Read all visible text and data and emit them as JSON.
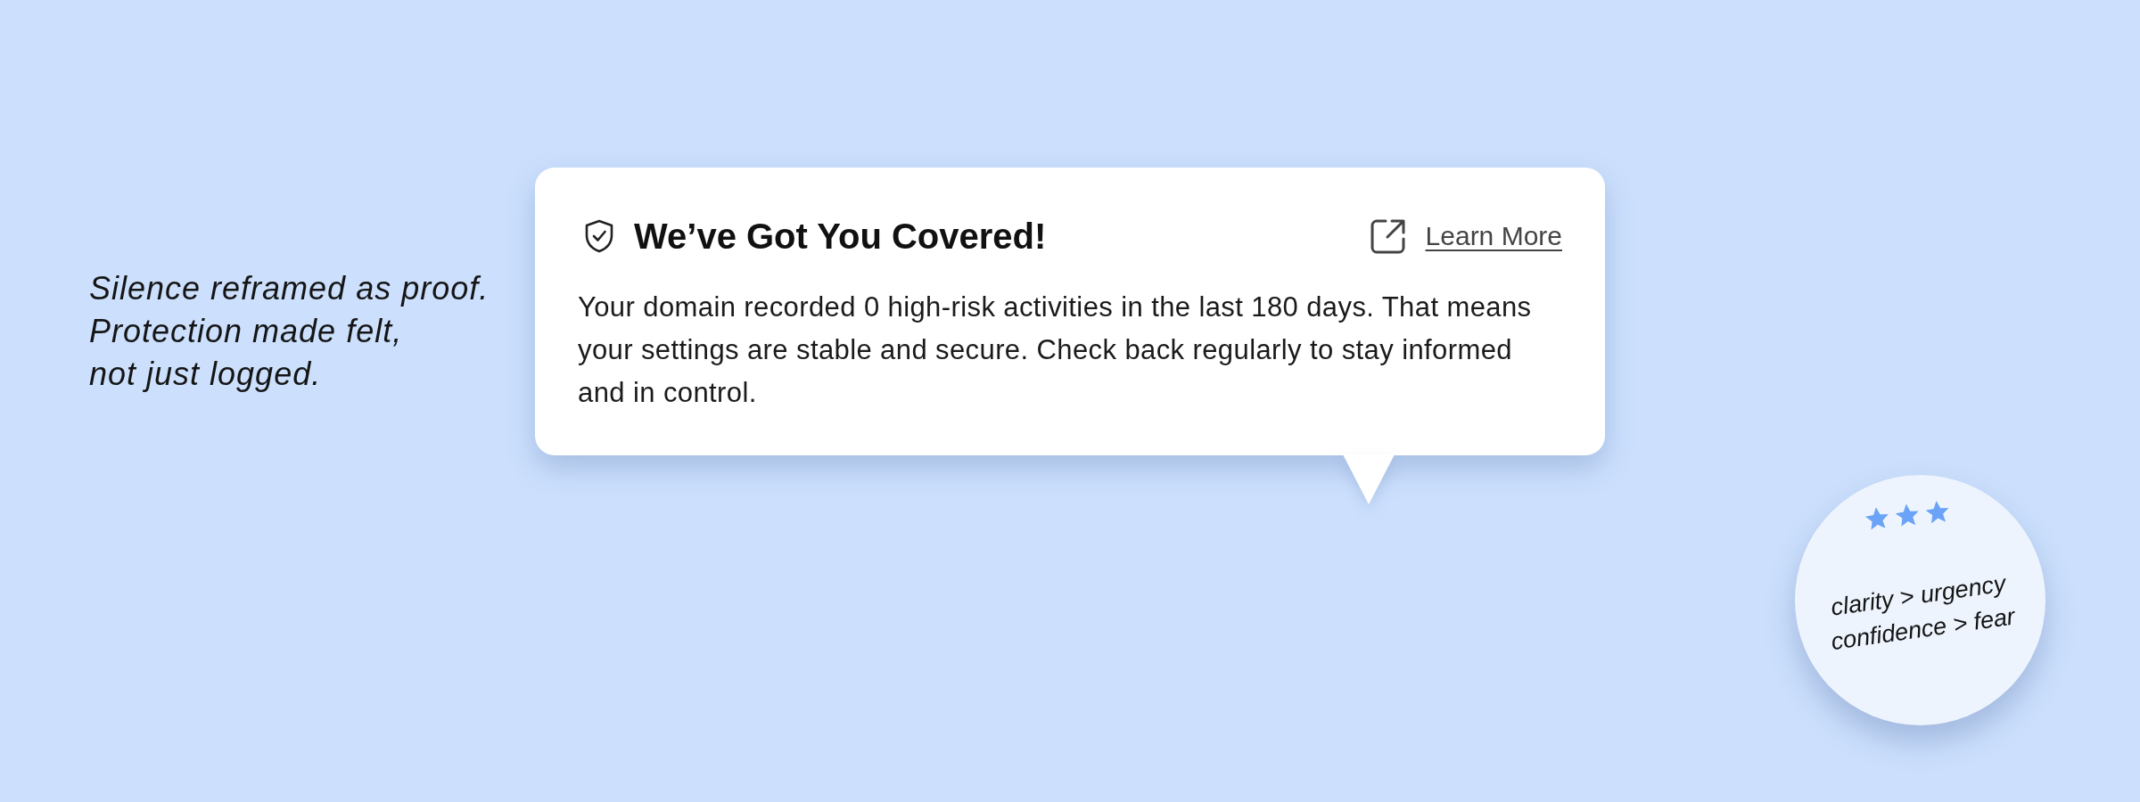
{
  "note": {
    "lines": [
      "Silence reframed as proof.",
      "Protection made felt,",
      "not just logged."
    ]
  },
  "tooltip": {
    "title": "We’ve Got You Covered!",
    "link": "Learn More",
    "body": "Your domain recorded 0 high-risk activities in the last 180 days. That means your settings are stable and secure. Check back regularly to stay informed and in control."
  },
  "badge": {
    "stars": 3,
    "lines": [
      "clarity > urgency",
      "confidence > fear"
    ]
  }
}
